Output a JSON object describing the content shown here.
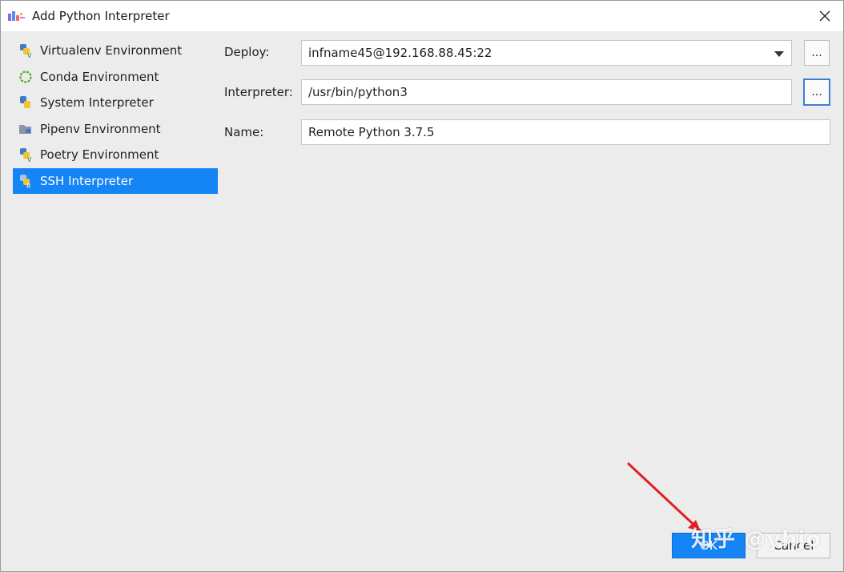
{
  "window": {
    "title": "Add Python Interpreter",
    "close_glyph": "✕"
  },
  "environments": [
    {
      "label": "Virtualenv Environment",
      "icon": "virtualenv-python-icon",
      "selected": false
    },
    {
      "label": "Conda Environment",
      "icon": "conda-icon",
      "selected": false
    },
    {
      "label": "System Interpreter",
      "icon": "python-icon",
      "selected": false
    },
    {
      "label": "Pipenv Environment",
      "icon": "pipenv-icon",
      "selected": false
    },
    {
      "label": "Poetry Environment",
      "icon": "poetry-python-icon",
      "selected": false
    },
    {
      "label": "SSH Interpreter",
      "icon": "ssh-python-icon",
      "selected": true
    }
  ],
  "form": {
    "deploy_label": "Deploy:",
    "deploy_value": "infname45@192.168.88.45:22",
    "interpreter_label": "Interpreter:",
    "interpreter_value": "/usr/bin/python3",
    "name_label": "Name:",
    "name_value": "Remote Python 3.7.5",
    "browse_label": "..."
  },
  "buttons": {
    "ok": "OK",
    "cancel": "Cancel"
  },
  "watermark": "知乎 @yhjo",
  "colors": {
    "selection": "#1584f5",
    "background": "#ececec",
    "annotation_arrow": "#e02020"
  }
}
